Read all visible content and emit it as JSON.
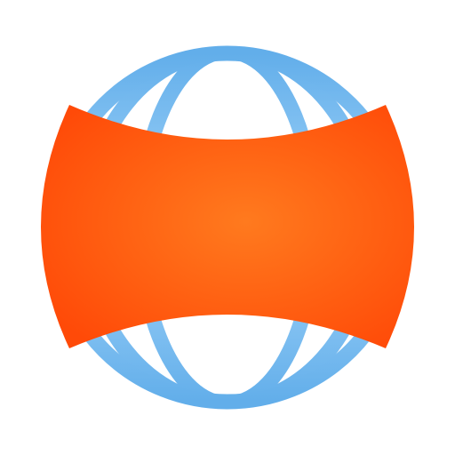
{
  "logo": {
    "icon": "globe-with-band-icon",
    "colors": {
      "grid_light": "#a6d6fa",
      "grid_dark": "#62aeea",
      "band_center": "#ff7a1e",
      "band_edge": "#ff4a08",
      "background": "#ffffff"
    }
  }
}
